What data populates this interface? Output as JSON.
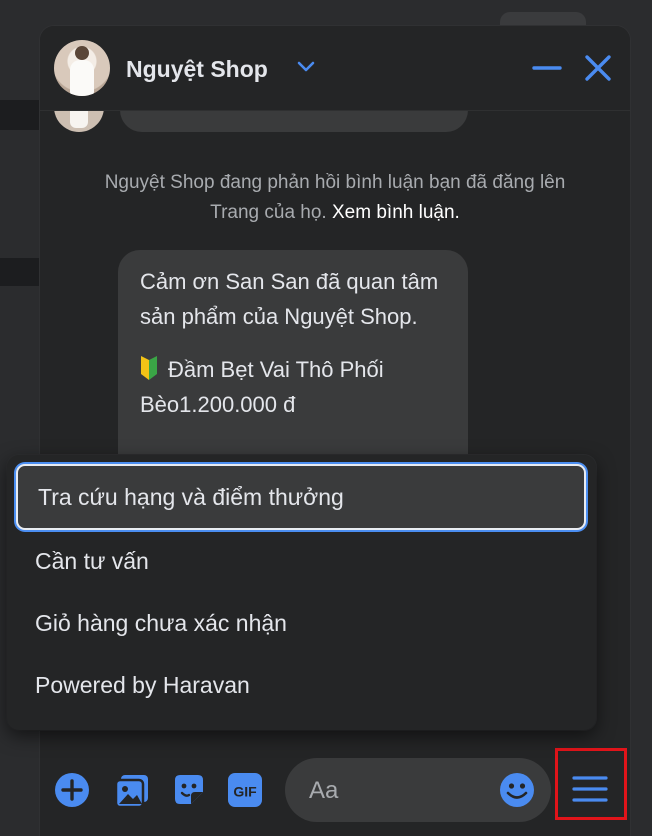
{
  "chat": {
    "shop_name": "Nguyệt Shop",
    "notice": {
      "text": "Nguyệt Shop đang phản hồi bình luận bạn đã đăng lên Trang của họ.",
      "link": "Xem bình luận."
    },
    "message": {
      "line1": "Cảm ơn San San đã quan tâm sản phẩm của Nguyệt Shop.",
      "product": "Đầm Bẹt Vai Thô Phối Bèo1.200.000 đ"
    },
    "composer": {
      "placeholder": "Aa"
    }
  },
  "menu": {
    "items": [
      {
        "label": "Tra cứu hạng và điểm thưởng",
        "selected": true
      },
      {
        "label": "Cần tư vấn"
      },
      {
        "label": "Giỏ hàng chưa xác nhận"
      },
      {
        "label": "Powered by Haravan"
      }
    ]
  },
  "colors": {
    "accent": "#4a8bf0",
    "highlight_box": "#e0141a",
    "background": "#242526",
    "bubble": "#3a3b3c"
  },
  "icons": [
    "chevron-down-icon",
    "minimize-icon",
    "close-icon",
    "plus-icon",
    "image-icon",
    "sticker-icon",
    "gif-icon",
    "emoji-icon",
    "hamburger-menu-icon",
    "beginner-mark-icon"
  ]
}
